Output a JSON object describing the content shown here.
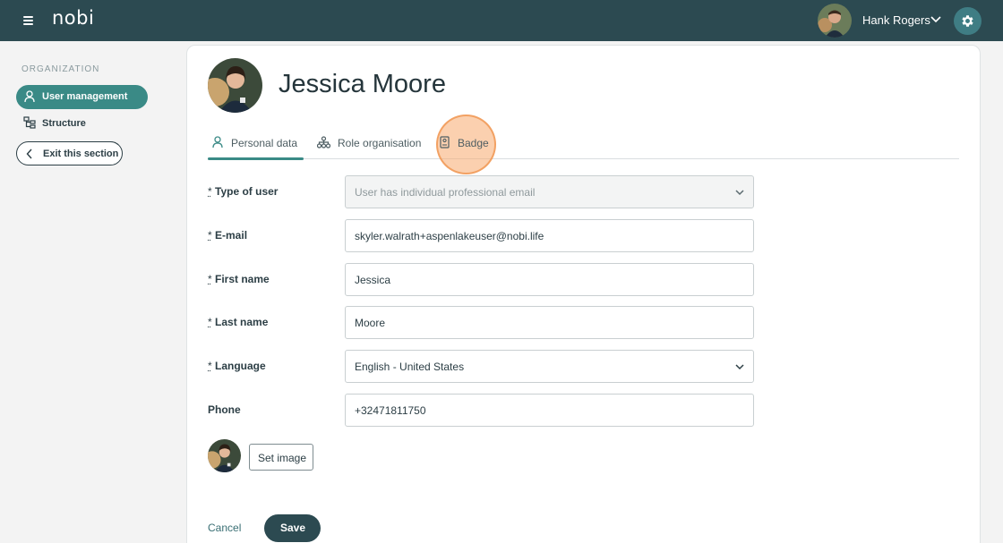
{
  "app": {
    "logo": "nobi",
    "menu_icon": "hamburger-menu-icon",
    "user_name": "Hank Rogers",
    "settings_icon": "gear-icon"
  },
  "sidebar": {
    "section_label": "ORGANIZATION",
    "items": [
      {
        "label": "User management",
        "icon": "user-icon",
        "active": true
      },
      {
        "label": "Structure",
        "icon": "structure-icon",
        "active": false
      }
    ],
    "exit_label": "Exit this section"
  },
  "profile": {
    "name": "Jessica Moore"
  },
  "tabs": [
    {
      "label": "Personal data",
      "icon": "person-icon",
      "active": true
    },
    {
      "label": "Role organisation",
      "icon": "org-chart-icon",
      "active": false
    },
    {
      "label": "Badge",
      "icon": "badge-icon",
      "active": false
    }
  ],
  "form": {
    "required_marker": "*",
    "type_of_user": {
      "label": "Type of user",
      "value": "User has individual professional email"
    },
    "email": {
      "label": "E-mail",
      "value": "skyler.walrath+aspenlakeuser@nobi.life"
    },
    "first_name": {
      "label": "First name",
      "value": "Jessica"
    },
    "last_name": {
      "label": "Last name",
      "value": "Moore"
    },
    "language": {
      "label": "Language",
      "value": "English - United States"
    },
    "phone": {
      "label": "Phone",
      "value": "+32471811750"
    },
    "set_image_label": "Set image"
  },
  "actions": {
    "cancel": "Cancel",
    "save": "Save"
  },
  "colors": {
    "topbar": "#2c4a51",
    "accent": "#3a8a86",
    "highlight": "#f7aa6e"
  }
}
